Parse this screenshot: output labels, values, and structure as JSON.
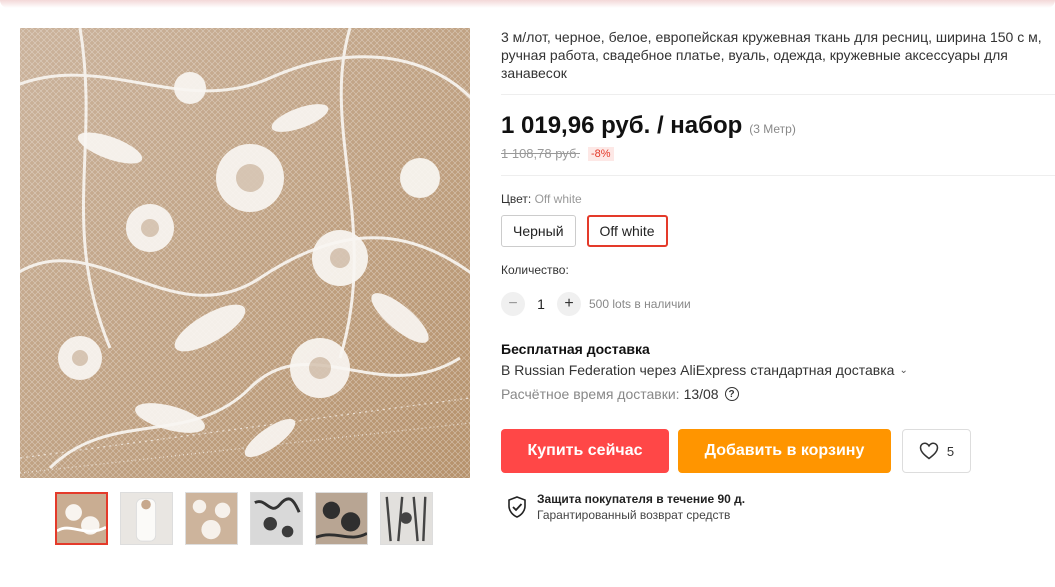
{
  "product": {
    "title": "3 м/лот, черное, белое, европейская кружевная ткань для ресниц, ширина 150 с м, ручная работа, свадебное платье, вуаль, одежда, кружевные аксессуары для занавесок",
    "price": "1 019,96 руб. / набор",
    "unit_note": "(3 Метр)",
    "old_price": "1 108,78 руб.",
    "discount": "-8%"
  },
  "color": {
    "label": "Цвет: ",
    "selected_value": "Off white",
    "options": [
      "Черный",
      "Off white"
    ]
  },
  "quantity": {
    "label": "Количество:",
    "minus": "−",
    "plus": "+",
    "value": "1",
    "stock": "500 lots в наличии"
  },
  "shipping": {
    "title": "Бесплатная доставка",
    "route": "В Russian Federation через AliExpress стандартная доставка",
    "route_chevron": "⌄",
    "eta_label": "Расчётное время доставки:",
    "eta_value": "13/08",
    "help": "?"
  },
  "actions": {
    "buy_now": "Купить сейчас",
    "add_to_cart": "Добавить в корзину",
    "wishlist_count": "5"
  },
  "protection": {
    "title": "Защита покупателя в течение 90 д.",
    "subtitle": "Гарантированный возврат средств"
  },
  "gallery": {
    "thumbnails": [
      "white-lace",
      "model-photo",
      "white-lace-closeup",
      "black-lace",
      "black-lace-closeup",
      "black-lace-wide"
    ],
    "active_index": 0
  },
  "colors": {
    "accent_red": "#ff4747",
    "accent_orange": "#ff9500",
    "selected_border": "#e43a2a"
  }
}
